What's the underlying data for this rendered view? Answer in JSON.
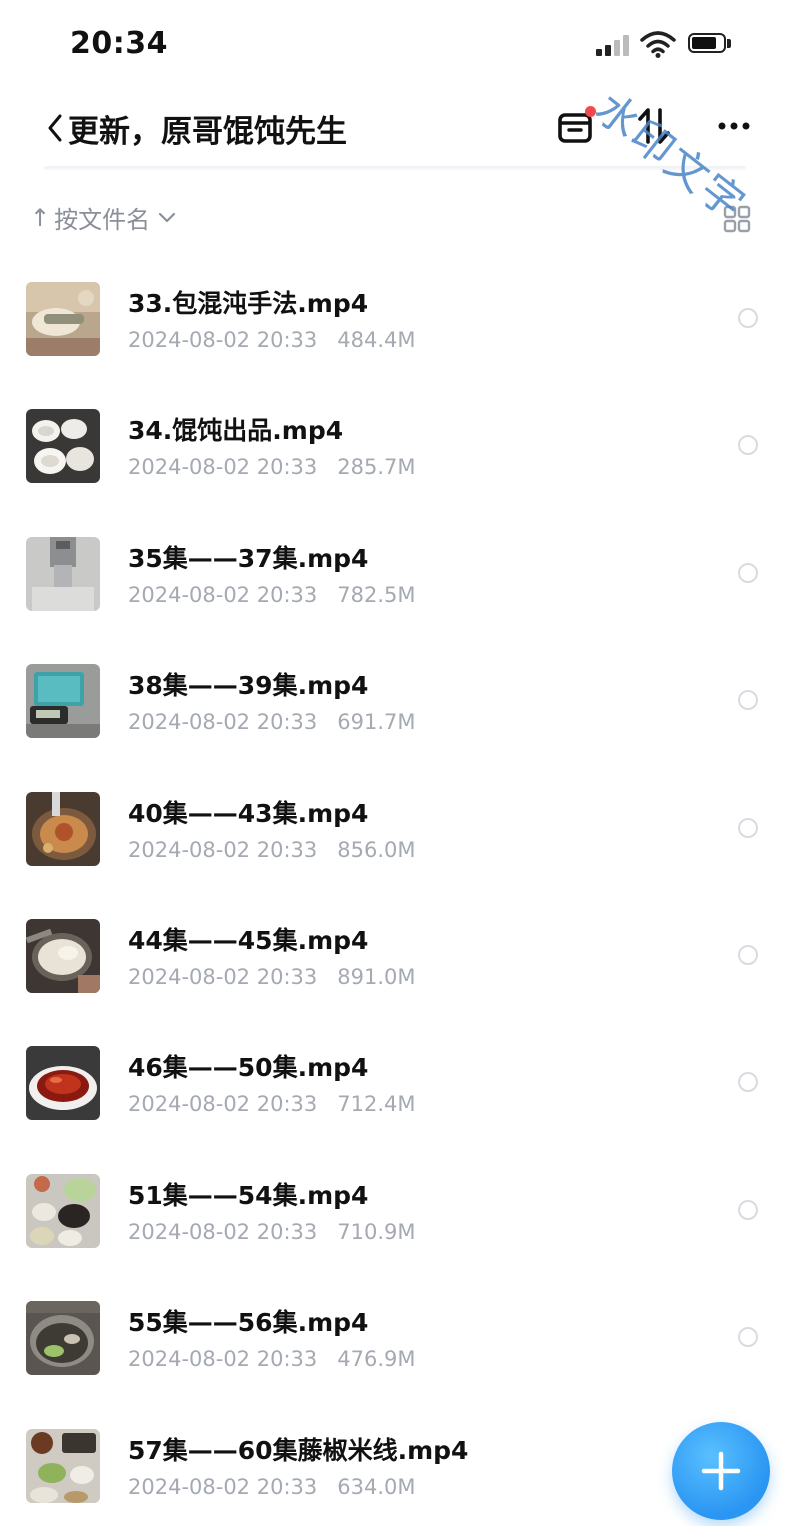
{
  "status_bar": {
    "time": "20:34"
  },
  "watermark": "水印文字",
  "nav": {
    "title": "更新，原哥馄饨先生"
  },
  "sort": {
    "label": "按文件名",
    "arrow": "↑"
  },
  "files": [
    {
      "name": "33.包混沌手法.mp4",
      "date": "2024-08-02 20:33",
      "size": "484.4M"
    },
    {
      "name": "34.馄饨出品.mp4",
      "date": "2024-08-02 20:33",
      "size": "285.7M"
    },
    {
      "name": "35集——37集.mp4",
      "date": "2024-08-02 20:33",
      "size": "782.5M"
    },
    {
      "name": "38集——39集.mp4",
      "date": "2024-08-02 20:33",
      "size": "691.7M"
    },
    {
      "name": "40集——43集.mp4",
      "date": "2024-08-02 20:33",
      "size": "856.0M"
    },
    {
      "name": "44集——45集.mp4",
      "date": "2024-08-02 20:33",
      "size": "891.0M"
    },
    {
      "name": "46集——50集.mp4",
      "date": "2024-08-02 20:33",
      "size": "712.4M"
    },
    {
      "name": "51集——54集.mp4",
      "date": "2024-08-02 20:33",
      "size": "710.9M"
    },
    {
      "name": "55集——56集.mp4",
      "date": "2024-08-02 20:33",
      "size": "476.9M"
    },
    {
      "name": "57集——60集藤椒米线.mp4",
      "date": "2024-08-02 20:33",
      "size": "634.0M"
    }
  ],
  "colors": {
    "accent": "#2a95f2",
    "badge": "#f04a4a",
    "meta_text": "#a4a9b2",
    "watermark": "#4a86c8"
  }
}
